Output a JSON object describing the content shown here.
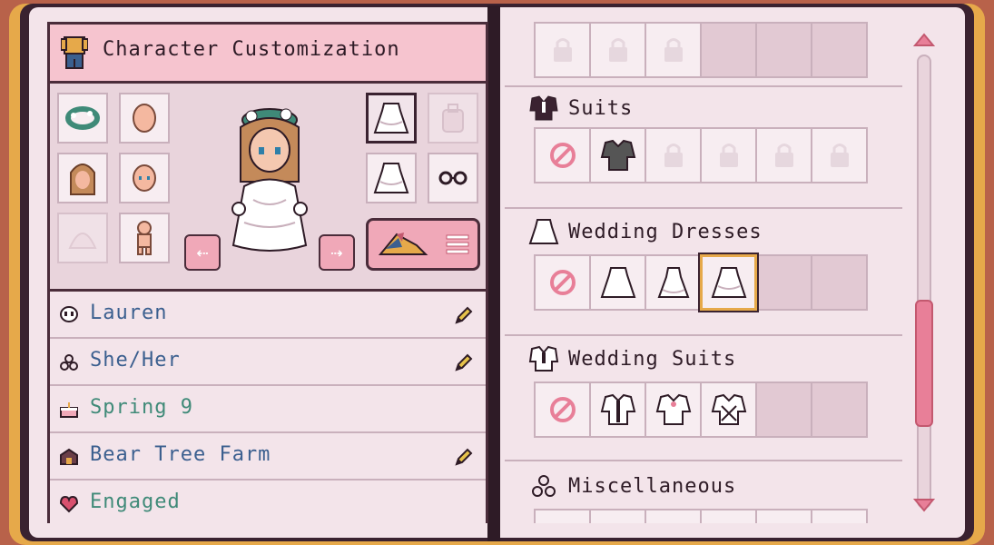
{
  "panel": {
    "title": "Character Customization"
  },
  "profile": {
    "name": "Lauren",
    "pronouns": "She/Her",
    "birthday": "Spring 9",
    "farm": "Bear Tree Farm",
    "status": "Engaged"
  },
  "sections": [
    {
      "name": "Suits"
    },
    {
      "name": "Wedding Dresses"
    },
    {
      "name": "Wedding Suits"
    },
    {
      "name": "Miscellaneous"
    }
  ],
  "colors": {
    "accent": "#f0a8b8",
    "selection": "#e6a94a",
    "name_text": "#3b5f8f",
    "status_text": "#3f8a78"
  },
  "scrollbar": {
    "position_fraction": 0.63
  }
}
